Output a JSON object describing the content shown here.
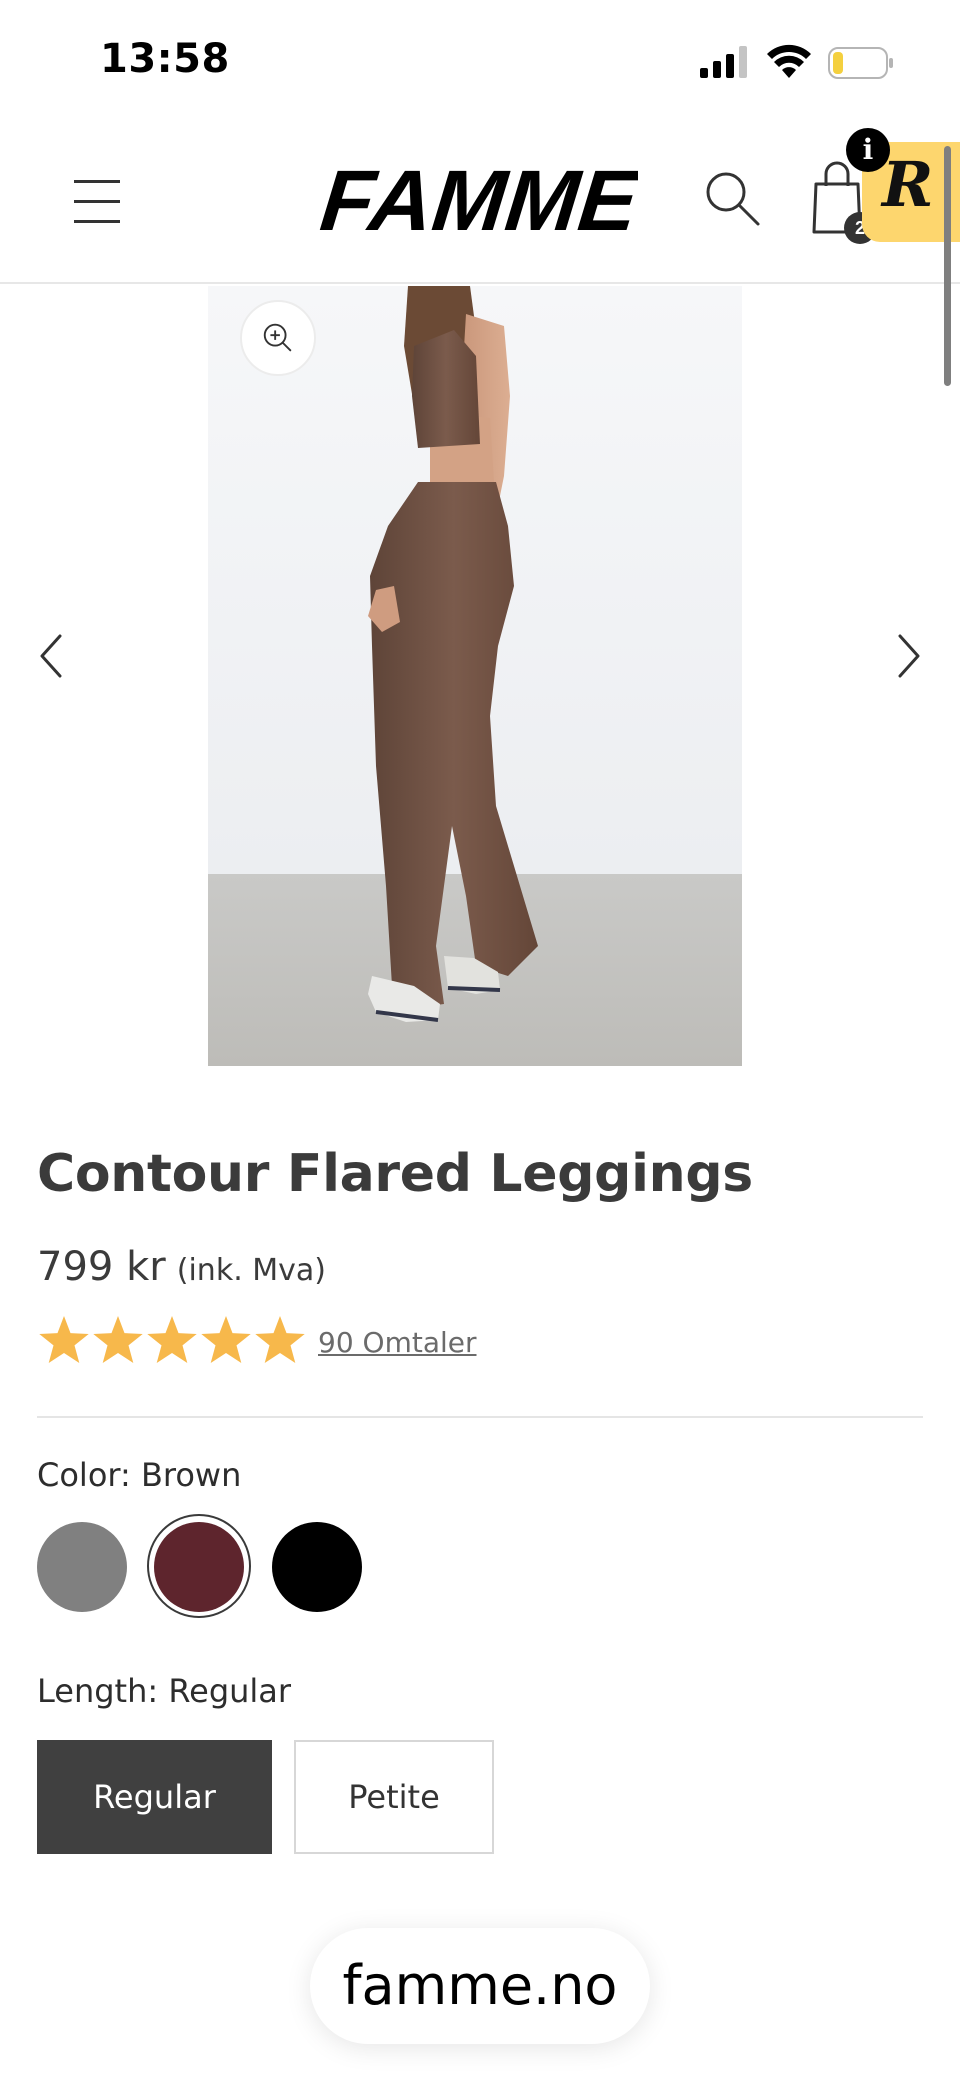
{
  "status_bar": {
    "time": "13:58",
    "icons": [
      "signal-icon",
      "wifi-icon",
      "battery-icon"
    ]
  },
  "header": {
    "brand": "FAMME",
    "menu_icon": "hamburger-menu-icon",
    "search_icon": "search-icon",
    "cart_icon": "shopping-bag-icon",
    "cart_count": "2",
    "widget_letter": "R",
    "info_badge": "i"
  },
  "gallery": {
    "zoom_icon": "zoom-in-icon",
    "prev_icon": "chevron-left-icon",
    "next_icon": "chevron-right-icon"
  },
  "product": {
    "title": "Contour Flared Leggings",
    "price": "799 kr",
    "vat_note": "(ink. Mva)",
    "rating": 5,
    "rating_max": 5,
    "star_color": "#f7b84b",
    "reviews_label": "90 Omtaler"
  },
  "color": {
    "label": "Color: Brown",
    "swatches": [
      {
        "color": "#808080",
        "selected": false
      },
      {
        "color": "#5e252d",
        "selected": true
      },
      {
        "color": "#000000",
        "selected": false
      }
    ]
  },
  "length": {
    "label": "Length: Regular",
    "options": [
      {
        "label": "Regular",
        "selected": true
      },
      {
        "label": "Petite",
        "selected": false
      }
    ]
  },
  "browser": {
    "url": "famme.no"
  }
}
